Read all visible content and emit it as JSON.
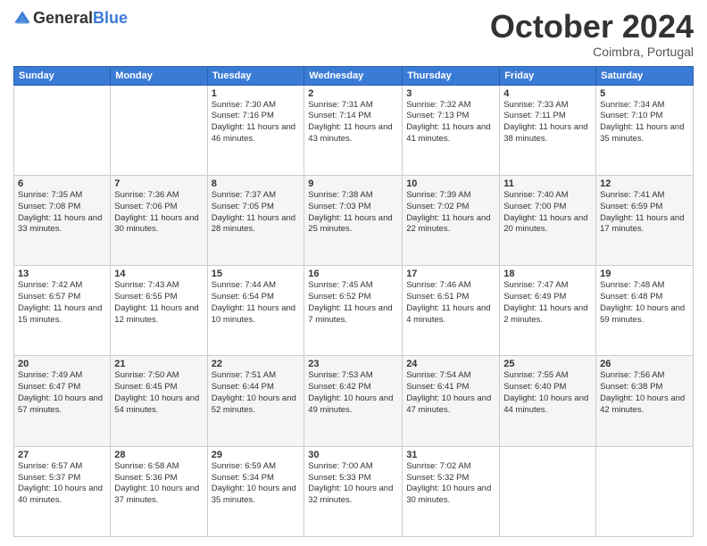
{
  "header": {
    "logo_general": "General",
    "logo_blue": "Blue",
    "month_title": "October 2024",
    "location": "Coimbra, Portugal"
  },
  "weekdays": [
    "Sunday",
    "Monday",
    "Tuesday",
    "Wednesday",
    "Thursday",
    "Friday",
    "Saturday"
  ],
  "weeks": [
    [
      {
        "day": "",
        "info": ""
      },
      {
        "day": "",
        "info": ""
      },
      {
        "day": "1",
        "info": "Sunrise: 7:30 AM\nSunset: 7:16 PM\nDaylight: 11 hours and 46 minutes."
      },
      {
        "day": "2",
        "info": "Sunrise: 7:31 AM\nSunset: 7:14 PM\nDaylight: 11 hours and 43 minutes."
      },
      {
        "day": "3",
        "info": "Sunrise: 7:32 AM\nSunset: 7:13 PM\nDaylight: 11 hours and 41 minutes."
      },
      {
        "day": "4",
        "info": "Sunrise: 7:33 AM\nSunset: 7:11 PM\nDaylight: 11 hours and 38 minutes."
      },
      {
        "day": "5",
        "info": "Sunrise: 7:34 AM\nSunset: 7:10 PM\nDaylight: 11 hours and 35 minutes."
      }
    ],
    [
      {
        "day": "6",
        "info": "Sunrise: 7:35 AM\nSunset: 7:08 PM\nDaylight: 11 hours and 33 minutes."
      },
      {
        "day": "7",
        "info": "Sunrise: 7:36 AM\nSunset: 7:06 PM\nDaylight: 11 hours and 30 minutes."
      },
      {
        "day": "8",
        "info": "Sunrise: 7:37 AM\nSunset: 7:05 PM\nDaylight: 11 hours and 28 minutes."
      },
      {
        "day": "9",
        "info": "Sunrise: 7:38 AM\nSunset: 7:03 PM\nDaylight: 11 hours and 25 minutes."
      },
      {
        "day": "10",
        "info": "Sunrise: 7:39 AM\nSunset: 7:02 PM\nDaylight: 11 hours and 22 minutes."
      },
      {
        "day": "11",
        "info": "Sunrise: 7:40 AM\nSunset: 7:00 PM\nDaylight: 11 hours and 20 minutes."
      },
      {
        "day": "12",
        "info": "Sunrise: 7:41 AM\nSunset: 6:59 PM\nDaylight: 11 hours and 17 minutes."
      }
    ],
    [
      {
        "day": "13",
        "info": "Sunrise: 7:42 AM\nSunset: 6:57 PM\nDaylight: 11 hours and 15 minutes."
      },
      {
        "day": "14",
        "info": "Sunrise: 7:43 AM\nSunset: 6:55 PM\nDaylight: 11 hours and 12 minutes."
      },
      {
        "day": "15",
        "info": "Sunrise: 7:44 AM\nSunset: 6:54 PM\nDaylight: 11 hours and 10 minutes."
      },
      {
        "day": "16",
        "info": "Sunrise: 7:45 AM\nSunset: 6:52 PM\nDaylight: 11 hours and 7 minutes."
      },
      {
        "day": "17",
        "info": "Sunrise: 7:46 AM\nSunset: 6:51 PM\nDaylight: 11 hours and 4 minutes."
      },
      {
        "day": "18",
        "info": "Sunrise: 7:47 AM\nSunset: 6:49 PM\nDaylight: 11 hours and 2 minutes."
      },
      {
        "day": "19",
        "info": "Sunrise: 7:48 AM\nSunset: 6:48 PM\nDaylight: 10 hours and 59 minutes."
      }
    ],
    [
      {
        "day": "20",
        "info": "Sunrise: 7:49 AM\nSunset: 6:47 PM\nDaylight: 10 hours and 57 minutes."
      },
      {
        "day": "21",
        "info": "Sunrise: 7:50 AM\nSunset: 6:45 PM\nDaylight: 10 hours and 54 minutes."
      },
      {
        "day": "22",
        "info": "Sunrise: 7:51 AM\nSunset: 6:44 PM\nDaylight: 10 hours and 52 minutes."
      },
      {
        "day": "23",
        "info": "Sunrise: 7:53 AM\nSunset: 6:42 PM\nDaylight: 10 hours and 49 minutes."
      },
      {
        "day": "24",
        "info": "Sunrise: 7:54 AM\nSunset: 6:41 PM\nDaylight: 10 hours and 47 minutes."
      },
      {
        "day": "25",
        "info": "Sunrise: 7:55 AM\nSunset: 6:40 PM\nDaylight: 10 hours and 44 minutes."
      },
      {
        "day": "26",
        "info": "Sunrise: 7:56 AM\nSunset: 6:38 PM\nDaylight: 10 hours and 42 minutes."
      }
    ],
    [
      {
        "day": "27",
        "info": "Sunrise: 6:57 AM\nSunset: 5:37 PM\nDaylight: 10 hours and 40 minutes."
      },
      {
        "day": "28",
        "info": "Sunrise: 6:58 AM\nSunset: 5:36 PM\nDaylight: 10 hours and 37 minutes."
      },
      {
        "day": "29",
        "info": "Sunrise: 6:59 AM\nSunset: 5:34 PM\nDaylight: 10 hours and 35 minutes."
      },
      {
        "day": "30",
        "info": "Sunrise: 7:00 AM\nSunset: 5:33 PM\nDaylight: 10 hours and 32 minutes."
      },
      {
        "day": "31",
        "info": "Sunrise: 7:02 AM\nSunset: 5:32 PM\nDaylight: 10 hours and 30 minutes."
      },
      {
        "day": "",
        "info": ""
      },
      {
        "day": "",
        "info": ""
      }
    ]
  ]
}
